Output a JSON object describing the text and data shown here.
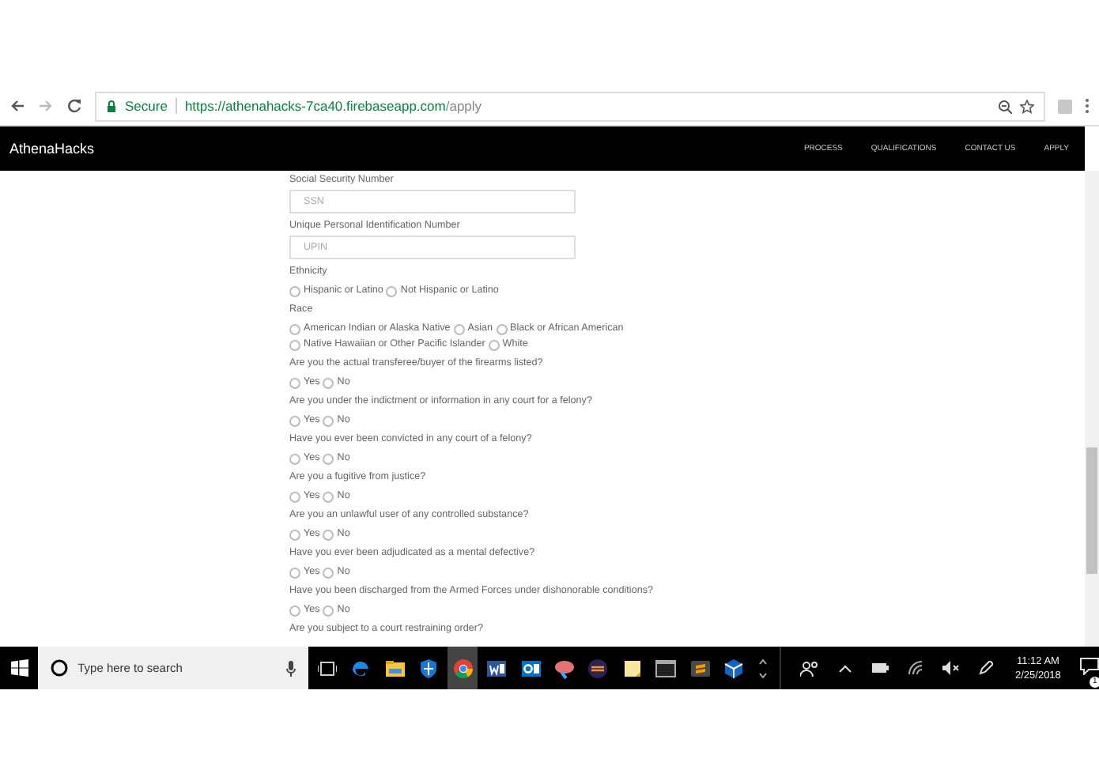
{
  "browser": {
    "secure_label": "Secure",
    "url_host": "https://athenahacks-7ca40.firebaseapp.com",
    "url_path": "/apply"
  },
  "navbar": {
    "brand": "AthenaHacks",
    "links": [
      "PROCESS",
      "QUALIFICATIONS",
      "CONTACT US",
      "APPLY"
    ]
  },
  "form": {
    "fields": [
      {
        "kind": "text",
        "label": "Social Security Number",
        "placeholder": "SSN"
      },
      {
        "kind": "text",
        "label": "Unique Personal Identification Number",
        "placeholder": "UPIN"
      },
      {
        "kind": "radio",
        "label": "Ethnicity",
        "options": [
          {
            "label": "Hispanic or Latino",
            "selected": false
          },
          {
            "label": "Not Hispanic or Latino",
            "selected": false
          }
        ]
      },
      {
        "kind": "radio",
        "label": "Race",
        "options": [
          {
            "label": "American Indian or Alaska Native",
            "selected": false
          },
          {
            "label": "Asian",
            "selected": false
          },
          {
            "label": "Black or African American",
            "selected": false
          },
          {
            "label": "Native Hawaiian or Other Pacific Islander",
            "selected": false
          },
          {
            "label": "White",
            "selected": false
          }
        ]
      },
      {
        "kind": "radio",
        "label": "Are you the actual transferee/buyer of the firearms listed?",
        "options": [
          {
            "label": "Yes",
            "selected": false
          },
          {
            "label": "No",
            "selected": false
          }
        ]
      },
      {
        "kind": "radio",
        "label": "Are you under the indictment or information in any court for a felony?",
        "options": [
          {
            "label": "Yes",
            "selected": false
          },
          {
            "label": "No",
            "selected": false
          }
        ]
      },
      {
        "kind": "radio",
        "label": "Have you ever been convicted in any court of a felony?",
        "options": [
          {
            "label": "Yes",
            "selected": false
          },
          {
            "label": "No",
            "selected": false
          }
        ]
      },
      {
        "kind": "radio",
        "label": "Are you a fugitive from justice?",
        "options": [
          {
            "label": "Yes",
            "selected": false
          },
          {
            "label": "No",
            "selected": false
          }
        ]
      },
      {
        "kind": "radio",
        "label": "Are you an unlawful user of any controlled substance?",
        "options": [
          {
            "label": "Yes",
            "selected": false
          },
          {
            "label": "No",
            "selected": false
          }
        ]
      },
      {
        "kind": "radio",
        "label": "Have you ever been adjudicated as a mental defective?",
        "options": [
          {
            "label": "Yes",
            "selected": false
          },
          {
            "label": "No",
            "selected": false
          }
        ]
      },
      {
        "kind": "radio",
        "label": "Have you been discharged from the Armed Forces under dishonorable conditions?",
        "options": [
          {
            "label": "Yes",
            "selected": false
          },
          {
            "label": "No",
            "selected": false
          }
        ]
      },
      {
        "kind": "radio",
        "label": "Are you subject to a court restraining order?"
      }
    ]
  },
  "taskbar": {
    "search_placeholder": "Type here to search",
    "apps": [
      {
        "kind": "edge",
        "active": false
      },
      {
        "kind": "explorer",
        "active": false
      },
      {
        "kind": "shield",
        "active": false
      },
      {
        "kind": "chrome",
        "active": true
      },
      {
        "kind": "word",
        "active": false
      },
      {
        "kind": "outlook",
        "active": false
      },
      {
        "kind": "paint",
        "active": false
      },
      {
        "kind": "eclipse",
        "active": false
      },
      {
        "kind": "notes",
        "active": false
      },
      {
        "kind": "terminal",
        "active": false
      },
      {
        "kind": "sublime",
        "active": false
      },
      {
        "kind": "cube",
        "active": false
      }
    ],
    "time": "11:12 AM",
    "date": "2/25/2018",
    "notification_count": "1"
  }
}
